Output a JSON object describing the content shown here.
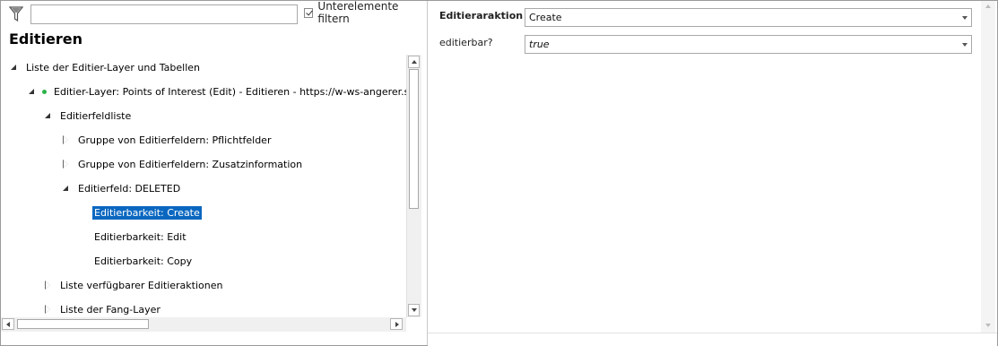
{
  "left_pane": {
    "filter": {
      "icon": "filter-icon",
      "value": ""
    },
    "sub_filter": {
      "label": "Unterelemente filtern",
      "checked": true
    },
    "title": "Editieren",
    "tree": [
      {
        "label": "Liste der Editier-Layer und Tabellen",
        "state": "open",
        "level": 0
      },
      {
        "label": "Editier-Layer: Points of Interest (Edit) - Editieren - https://w-ws-angerer.synergis.local/arcgis/rest/services/Kommunal/Points_of_Interest_Edit/FeatureServer",
        "state": "open",
        "level": 1,
        "status_dot": true
      },
      {
        "label": "Editierfeldliste",
        "state": "open",
        "level": 2
      },
      {
        "label": "Gruppe von Editierfeldern: Pflichtfelder",
        "state": "closed",
        "level": 3
      },
      {
        "label": "Gruppe von Editierfeldern: Zusatzinformation",
        "state": "closed",
        "level": 3
      },
      {
        "label": "Editierfeld: DELETED",
        "state": "open",
        "level": 3
      },
      {
        "label": "Editierbarkeit: Create",
        "state": "leaf",
        "level": 4,
        "selected": true
      },
      {
        "label": "Editierbarkeit: Edit",
        "state": "leaf",
        "level": 4
      },
      {
        "label": "Editierbarkeit: Copy",
        "state": "leaf",
        "level": 4
      },
      {
        "label": "Liste verfügbarer Editieraktionen",
        "state": "closed",
        "level": 2
      },
      {
        "label": "Liste der Fang-Layer",
        "state": "closed",
        "level": 2
      }
    ]
  },
  "right_pane": {
    "properties": [
      {
        "label": "Editieraraktion !",
        "value": "Create",
        "bold": true,
        "italic": false
      },
      {
        "label": "editierbar?",
        "value": "true",
        "bold": false,
        "italic": true
      }
    ]
  },
  "colors": {
    "selection": "#0a67c0",
    "status_dot": "#2db34a"
  }
}
